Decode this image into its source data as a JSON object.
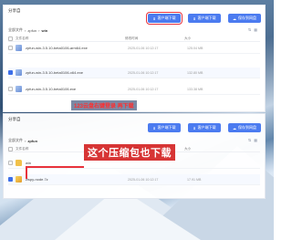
{
  "top_panel": {
    "share_from": "分享自",
    "buttons": {
      "pc_download": "客户端下载",
      "client_download": "客户端下载",
      "save_to_drive": "保存到网盘"
    },
    "breadcrumb": [
      "全部文件",
      "zpfun",
      "win"
    ],
    "table_header": {
      "name": "文件名称",
      "date": "修改时间",
      "size": "大小"
    },
    "rows": [
      {
        "name": "zpfun-win-3.5.10-beta0106-arm64.exe",
        "date": "2025-01-06 10:12:17",
        "size": "125.04 MB",
        "checked": false,
        "icon": "exe-file-icon"
      },
      {
        "name": "zpfun-win-3.5.10-beta0106-x64.exe",
        "date": "2025-01-06 10:12:17",
        "size": "132.80 MB",
        "checked": true,
        "icon": "exe-file-icon"
      },
      {
        "name": "zpfun-win-3.5.10-beta0106.exe",
        "date": "2025-01-06 10:12:17",
        "size": "133.38 MB",
        "checked": false,
        "icon": "exe-file-icon"
      }
    ]
  },
  "bottom_panel": {
    "share_from": "分享自",
    "buttons": {
      "pc_download": "客户端下载",
      "client_download": "客户端下载",
      "save_to_drive": "保存到网盘"
    },
    "breadcrumb": [
      "全部文件",
      "zpfun"
    ],
    "table_header": {
      "name": "文件名称",
      "date": "修改时间",
      "size": "大小"
    },
    "rows": [
      {
        "name": "win",
        "date": "",
        "size": "",
        "checked": false,
        "icon": "folder-icon"
      },
      {
        "name": "zispy-node.7z",
        "date": "2025-01-06 10:12:17",
        "size": "17.91 MB",
        "checked": true,
        "icon": "archive-file-icon"
      }
    ]
  },
  "annotations": {
    "small_note": "123云盘右键登录 再下载",
    "big_note": "这个压缩包也下载"
  },
  "colors": {
    "accent": "#4b7bf0",
    "highlight": "#e8323c",
    "checkbox_on": "#3d6fe8"
  }
}
